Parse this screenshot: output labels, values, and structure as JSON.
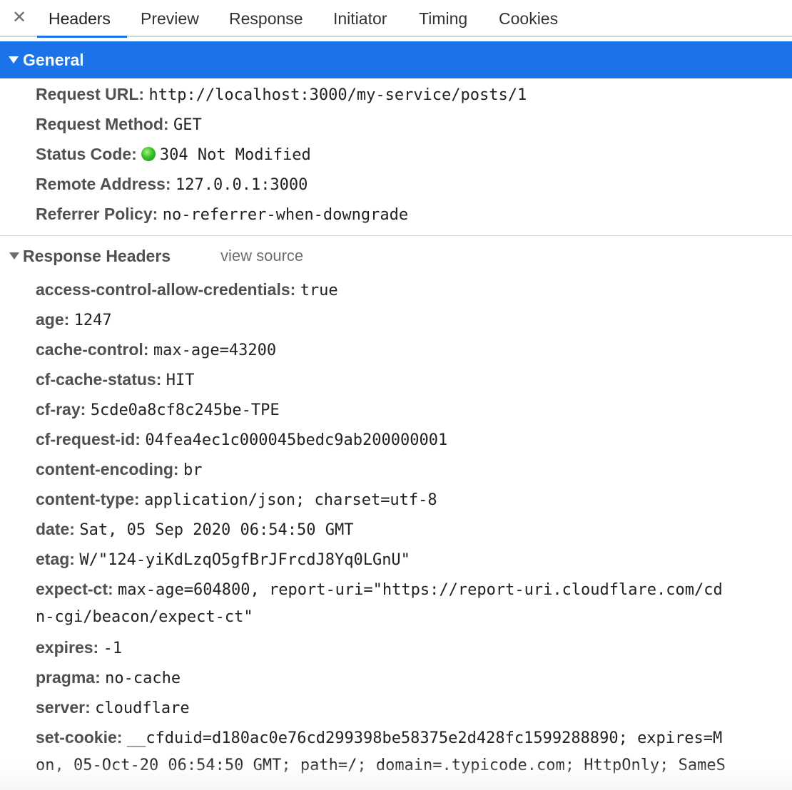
{
  "tabs": {
    "close": "✕",
    "items": [
      "Headers",
      "Preview",
      "Response",
      "Initiator",
      "Timing",
      "Cookies"
    ],
    "active": "Headers"
  },
  "general": {
    "title": "General",
    "rows": [
      {
        "key": "Request URL:",
        "value": "http://localhost:3000/my-service/posts/1"
      },
      {
        "key": "Request Method:",
        "value": "GET"
      },
      {
        "key": "Status Code:",
        "value": "304 Not Modified",
        "status_color": "#38c128"
      },
      {
        "key": "Remote Address:",
        "value": "127.0.0.1:3000"
      },
      {
        "key": "Referrer Policy:",
        "value": "no-referrer-when-downgrade"
      }
    ]
  },
  "response_headers": {
    "title": "Response Headers",
    "view_source": "view source",
    "rows": [
      {
        "key": "access-control-allow-credentials:",
        "value": "true"
      },
      {
        "key": "age:",
        "value": "1247"
      },
      {
        "key": "cache-control:",
        "value": "max-age=43200"
      },
      {
        "key": "cf-cache-status:",
        "value": "HIT"
      },
      {
        "key": "cf-ray:",
        "value": "5cde0a8cf8c245be-TPE"
      },
      {
        "key": "cf-request-id:",
        "value": "04fea4ec1c000045bedc9ab200000001"
      },
      {
        "key": "content-encoding:",
        "value": "br"
      },
      {
        "key": "content-type:",
        "value": "application/json; charset=utf-8"
      },
      {
        "key": "date:",
        "value": "Sat, 05 Sep 2020 06:54:50 GMT"
      },
      {
        "key": "etag:",
        "value": "W/\"124-yiKdLzqO5gfBrJFrcdJ8Yq0LGnU\""
      },
      {
        "key": "expect-ct:",
        "value": "max-age=604800, report-uri=\"https://report-uri.cloudflare.com/cd",
        "continuation": "n-cgi/beacon/expect-ct\""
      },
      {
        "key": "expires:",
        "value": "-1"
      },
      {
        "key": "pragma:",
        "value": "no-cache"
      },
      {
        "key": "server:",
        "value": "cloudflare"
      },
      {
        "key": "set-cookie:",
        "value": "__cfduid=d180ac0e76cd299398be58375e2d428fc1599288890; expires=M",
        "continuation": "on, 05-Oct-20 06:54:50 GMT; path=/; domain=.typicode.com; HttpOnly; SameS"
      }
    ]
  },
  "colors": {
    "accent": "#1a73e8",
    "status_ok": "#38c128"
  }
}
